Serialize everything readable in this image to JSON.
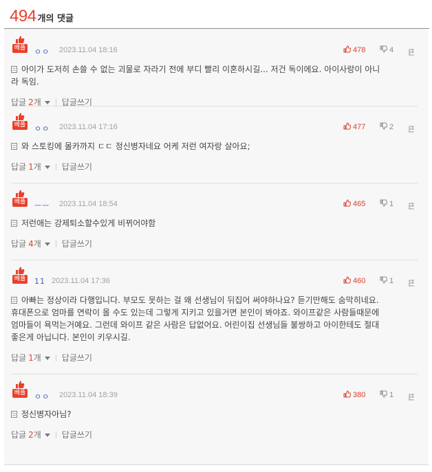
{
  "header": {
    "count": "494",
    "label": "개의 댓글"
  },
  "labels": {
    "best": "베플",
    "reply": "답글",
    "write_reply": "답글쓰기"
  },
  "colors": {
    "accent": "#e8412c",
    "author": "#3a5fb8"
  },
  "comments": [
    {
      "author": "ㅇㅇ",
      "date": "2023.11.04 18:16",
      "likes": "478",
      "dislikes": "4",
      "lines": [
        "아이가 도저히 손쓸 수 없는 괴물로 자라기 전에 부디 빨리 이혼하시길... 저건 독이에요. 아이사랑이 아니",
        "라 독임."
      ],
      "reply_count": "2",
      "reply_unit": "개"
    },
    {
      "author": "ㅇㅇ",
      "date": "2023.11.04 17:16",
      "likes": "477",
      "dislikes": "2",
      "lines": [
        "와 스토킹에 몰카까지 ㄷㄷ 정신병자네요 어케 저런 여자랑 살아요;"
      ],
      "reply_count": "1",
      "reply_unit": "개"
    },
    {
      "author": "ㅡㅡ",
      "date": "2023.11.04 18:54",
      "likes": "465",
      "dislikes": "1",
      "lines": [
        "저런애는 강제퇴소할수있게 비뀌어야함"
      ],
      "reply_count": "4",
      "reply_unit": "개"
    },
    {
      "author": "11",
      "date": "2023.11.04 17:36",
      "likes": "460",
      "dislikes": "1",
      "lines": [
        "아빠는 정상이라 다행입니다. 부모도 못하는 걸 왜 선생님이 뒤집어 써야하나요? 듣기만해도 숨막히네요.",
        "휴대폰으로 엄마를 연락이 올 수도 있는데 그렇게 지키고 있을거면 본인이 봐야죠. 와이프같은 사람들때문에",
        "엄마들이 욕먹는거예요. 그런데 와이프 같은 사람은 답없어요. 어린이집 선생님들 불쌍하고 아이한테도 절대",
        "좋은게 아닙니다. 본인이 키우시길."
      ],
      "reply_count": "1",
      "reply_unit": "개"
    },
    {
      "author": "ㅇㅇ",
      "date": "2023.11.04 18:39",
      "likes": "380",
      "dislikes": "1",
      "lines": [
        "정신병자아님?"
      ],
      "reply_count": "2",
      "reply_unit": "개"
    }
  ]
}
